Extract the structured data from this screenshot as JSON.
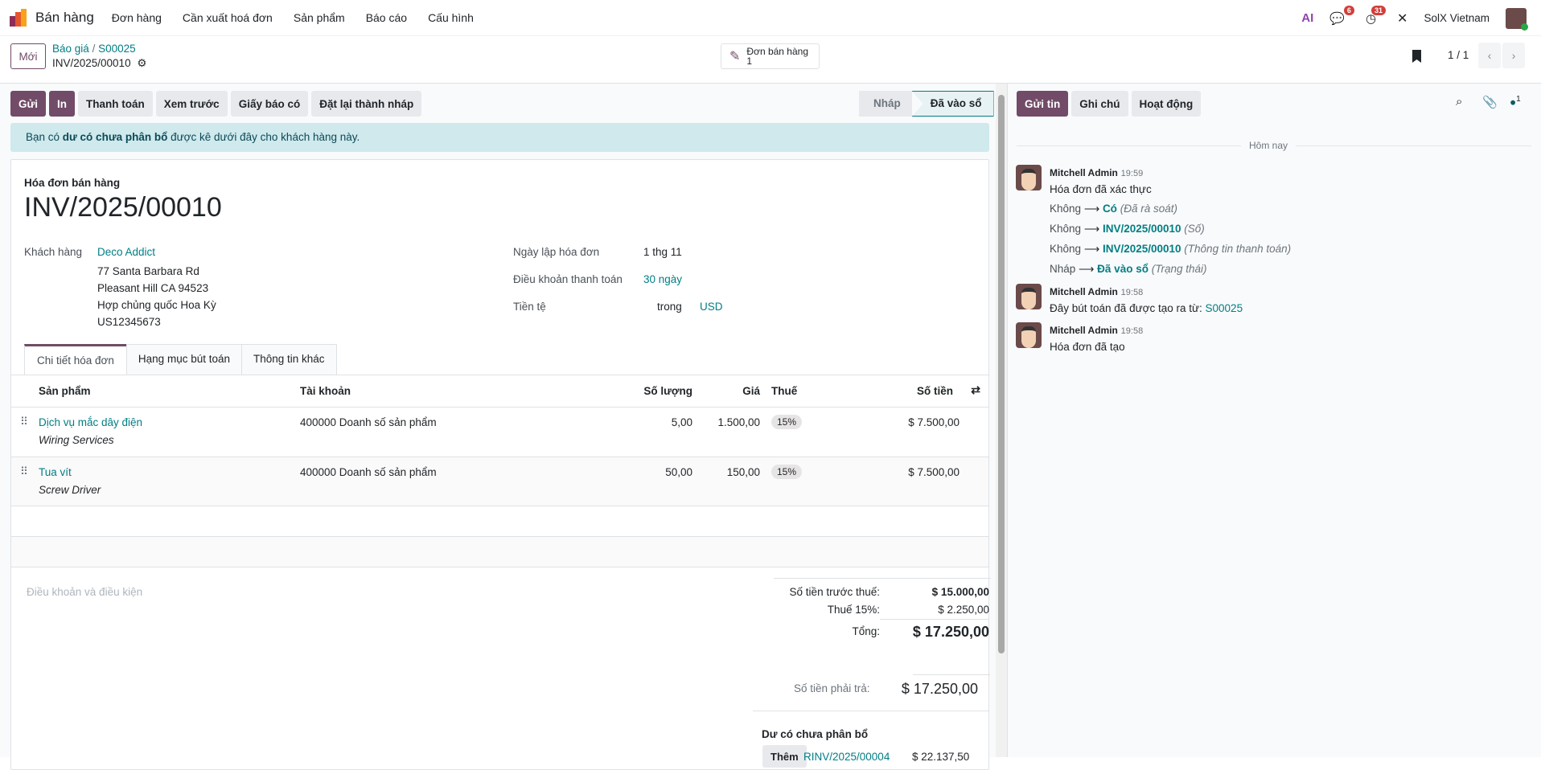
{
  "nav": {
    "app": "Bán hàng",
    "menu": [
      "Đơn hàng",
      "Cần xuất hoá đơn",
      "Sản phẩm",
      "Báo cáo",
      "Cấu hình"
    ],
    "ai": "AI",
    "messages_count": "6",
    "activities_count": "31",
    "company": "SolX Vietnam"
  },
  "control": {
    "new": "Mới",
    "breadcrumb": [
      "Báo giá",
      "S00025"
    ],
    "record": "INV/2025/00010",
    "smart_button": {
      "label": "Đơn bán hàng",
      "count": "1"
    },
    "pager": "1 / 1"
  },
  "actions": [
    "Gửi",
    "In",
    "Thanh toán",
    "Xem trước",
    "Giấy báo có",
    "Đặt lại thành nháp"
  ],
  "status": {
    "steps": [
      "Nháp",
      "Đã vào sổ"
    ],
    "active": "Đã vào sổ"
  },
  "alert": {
    "pre": "Bạn có ",
    "bold": "dư có chưa phân bổ",
    "post": " được kê dưới đây cho khách hàng này."
  },
  "invoice": {
    "type": "Hóa đơn bán hàng",
    "number": "INV/2025/00010",
    "customer_label": "Khách hàng",
    "customer": "Deco Addict",
    "address": [
      "77 Santa Barbara Rd",
      "Pleasant Hill CA 94523",
      "Hợp chủng quốc Hoa Kỳ",
      "US12345673"
    ],
    "date_label": "Ngày lập hóa đơn",
    "date": "1 thg 11",
    "terms_label": "Điều khoản thanh toán",
    "terms": "30 ngày",
    "currency_label": "Tiền tệ",
    "currency_in": "trong",
    "currency": "USD"
  },
  "tabs": [
    "Chi tiết hóa đơn",
    "Hạng mục bút toán",
    "Thông tin khác"
  ],
  "table": {
    "headers": [
      "Sản phẩm",
      "Tài khoản",
      "Số lượng",
      "Giá",
      "Thuế",
      "Số tiền"
    ],
    "rows": [
      {
        "product": "Dịch vụ mắc dây điện",
        "desc": "Wiring Services",
        "account": "400000 Doanh số sản phẩm",
        "qty": "5,00",
        "price": "1.500,00",
        "tax": "15%",
        "amount": "$ 7.500,00"
      },
      {
        "product": "Tua vít",
        "desc": "Screw Driver",
        "account": "400000 Doanh số sản phẩm",
        "qty": "50,00",
        "price": "150,00",
        "tax": "15%",
        "amount": "$ 7.500,00"
      }
    ]
  },
  "terms_placeholder": "Điều khoản và điều kiện",
  "totals": {
    "untaxed_label": "Số tiền trước thuế:",
    "untaxed": "$ 15.000,00",
    "tax_label": "Thuế 15%:",
    "tax": "$ 2.250,00",
    "total_label": "Tổng:",
    "total": "$ 17.250,00",
    "due_label": "Số tiền phải trả:",
    "due": "$ 17.250,00"
  },
  "credits": {
    "title": "Dư có chưa phân bổ",
    "add": "Thêm",
    "ref": "RINV/2025/00004",
    "amount": "$ 22.137,50"
  },
  "chatter": {
    "buttons": [
      "Gửi tin",
      "Ghi chú",
      "Hoạt động"
    ],
    "followers": "1",
    "today": "Hôm nay",
    "messages": [
      {
        "author": "Mitchell Admin",
        "time": "19:59",
        "body": "Hóa đơn đã xác thực",
        "changes": [
          {
            "old": "Không",
            "new": "Có",
            "field": "(Đã rà soát)"
          },
          {
            "old": "Không",
            "new": "INV/2025/00010",
            "field": "(Số)"
          },
          {
            "old": "Không",
            "new": "INV/2025/00010",
            "field": "(Thông tin thanh toán)"
          },
          {
            "old": "Nháp",
            "new": "Đã vào sổ",
            "field": "(Trạng thái)"
          }
        ]
      },
      {
        "author": "Mitchell Admin",
        "time": "19:58",
        "body": "Đây bút toán đã được tạo ra từ: ",
        "link": "S00025"
      },
      {
        "author": "Mitchell Admin",
        "time": "19:58",
        "body": "Hóa đơn đã tạo"
      }
    ]
  }
}
